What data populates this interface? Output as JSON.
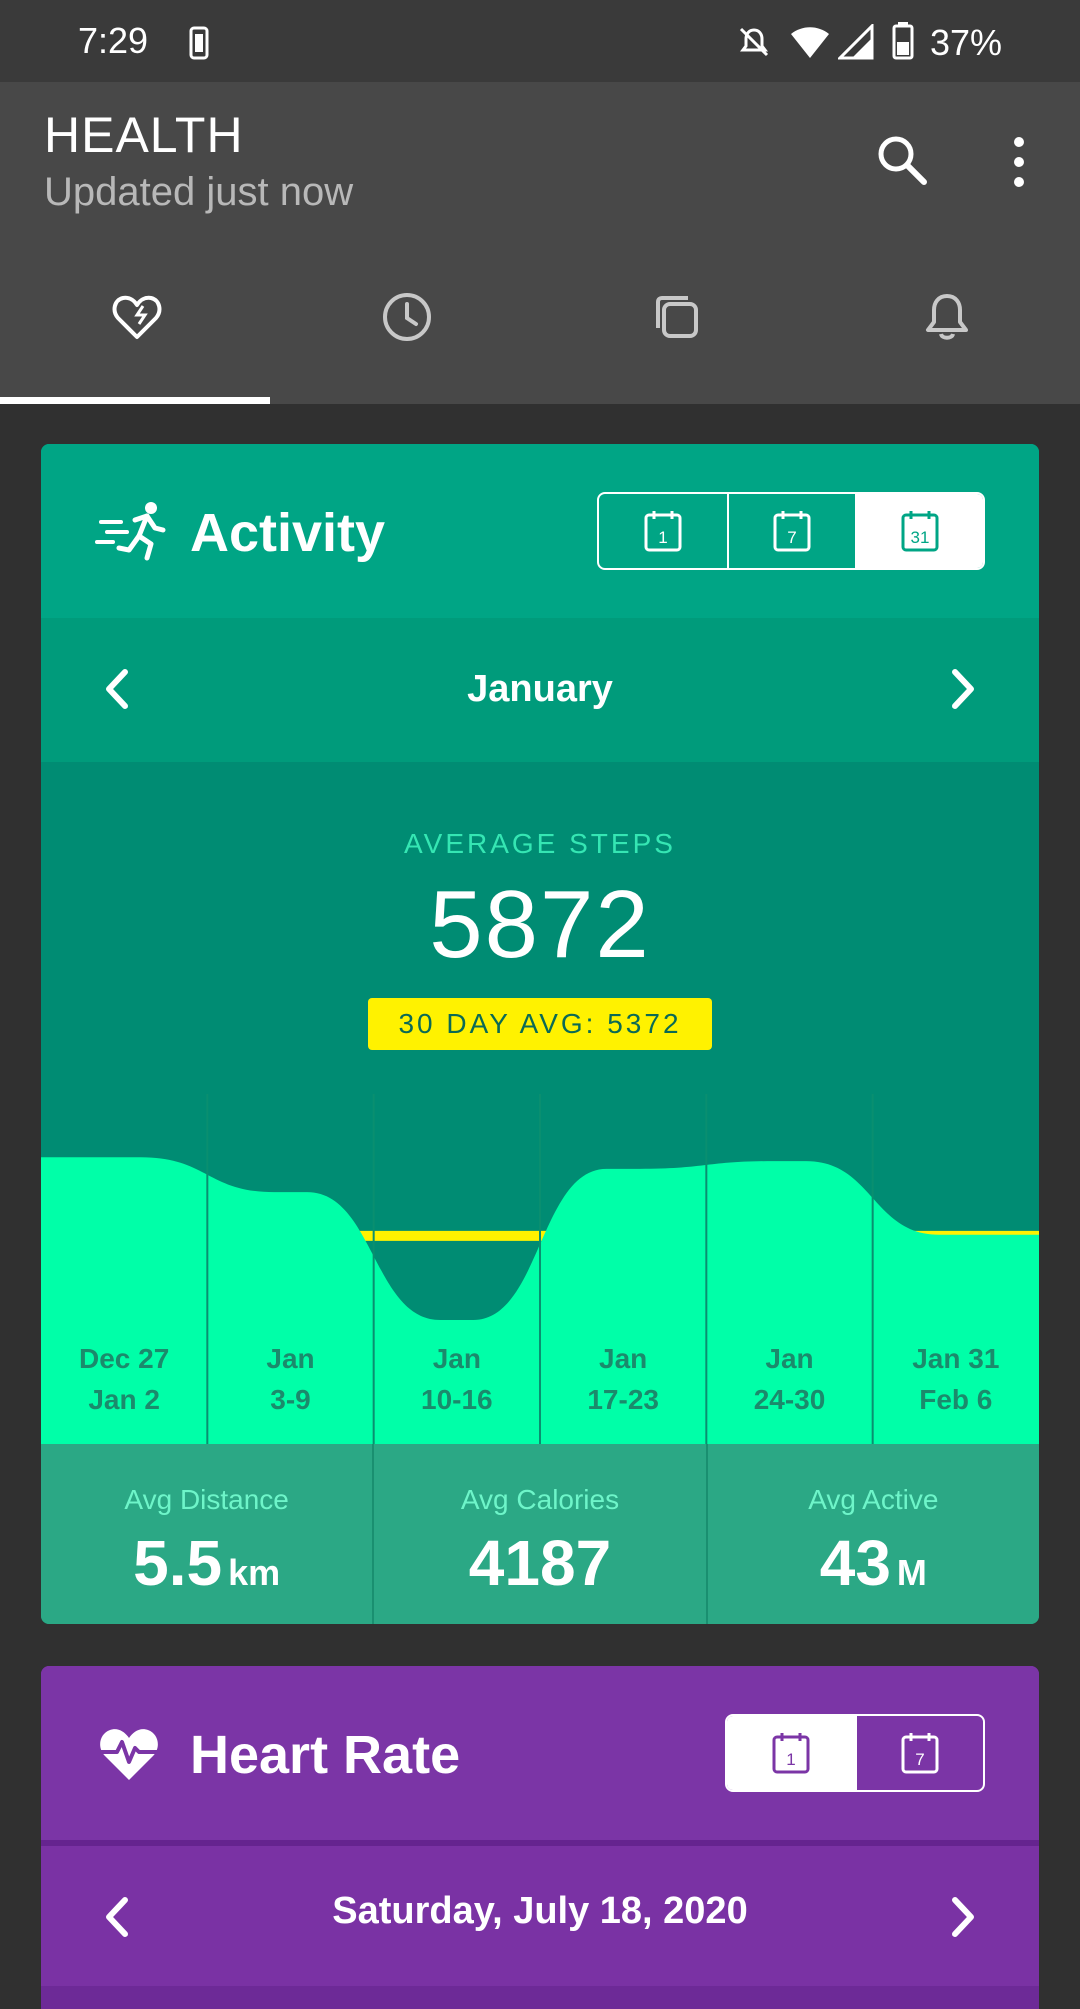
{
  "status_bar": {
    "time": "7:29",
    "battery": "37%"
  },
  "app_bar": {
    "title": "HEALTH",
    "subtitle": "Updated just now"
  },
  "tabs": [
    {
      "icon": "heart-check-icon",
      "selected": true
    },
    {
      "icon": "clock-icon",
      "selected": false
    },
    {
      "icon": "copy-icon",
      "selected": false
    },
    {
      "icon": "bell-icon",
      "selected": false
    }
  ],
  "activity": {
    "title": "Activity",
    "range_buttons": [
      "1",
      "7",
      "31"
    ],
    "selected_range": "31",
    "period": "January",
    "average_steps_label": "AVERAGE STEPS",
    "average_steps": "5872",
    "thirty_day_avg": "30 DAY AVG: 5372",
    "stats": [
      {
        "label": "Avg Distance",
        "value": "5.5",
        "unit": "km"
      },
      {
        "label": "Avg Calories",
        "value": "4187",
        "unit": ""
      },
      {
        "label": "Avg Active",
        "value": "43",
        "unit": "M"
      }
    ],
    "colors": {
      "fill": "#00ffa8",
      "line": "#fff200",
      "card": "#009a7e"
    }
  },
  "chart_data": {
    "type": "area",
    "categories": [
      "Dec 27\nJan 2",
      "Jan\n3-9",
      "Jan\n10-16",
      "Jan\n17-23",
      "Jan\n24-30",
      "Jan 31\nFeb 6"
    ],
    "category_lines": [
      [
        "Dec 27",
        "Jan 2"
      ],
      [
        "Jan",
        "3-9"
      ],
      [
        "Jan",
        "10-16"
      ],
      [
        "Jan",
        "17-23"
      ],
      [
        "Jan",
        "24-30"
      ],
      [
        "Jan 31",
        "Feb 6"
      ]
    ],
    "series": [
      {
        "values": [
          7400,
          6500,
          3200,
          7100,
          7300,
          5400
        ]
      }
    ],
    "reference_line": 5372,
    "ylim": [
      0,
      8000
    ]
  },
  "heart_rate": {
    "title": "Heart Rate",
    "range_buttons": [
      "1",
      "7"
    ],
    "selected_range": "1",
    "date": "Saturday, July 18, 2020"
  }
}
